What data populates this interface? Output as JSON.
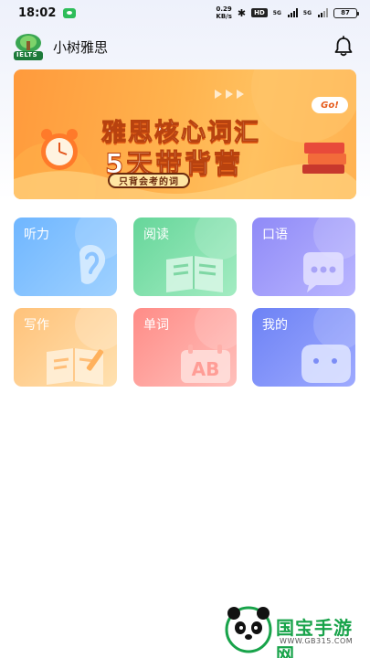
{
  "status_bar": {
    "time": "18:02",
    "net_speed_value": "0.29",
    "net_speed_unit": "KB/s",
    "hd": "HD",
    "sim1": "5G",
    "sim2": "5G",
    "battery": "87"
  },
  "header": {
    "app_name": "小树雅思",
    "logo_text": "IELTS"
  },
  "banner": {
    "line1": "雅思核心词汇",
    "line2": "5天带背营",
    "subtitle": "只背会考的词",
    "go_badge": "Go!"
  },
  "tiles": [
    {
      "label": "听力",
      "icon": "ear-icon"
    },
    {
      "label": "阅读",
      "icon": "book-icon"
    },
    {
      "label": "口语",
      "icon": "chat-bubble-icon"
    },
    {
      "label": "写作",
      "icon": "notebook-pen-icon"
    },
    {
      "label": "单词",
      "icon": "calendar-ab-icon"
    },
    {
      "label": "我的",
      "icon": "face-icon"
    }
  ],
  "watermark": {
    "text": "国宝手游网",
    "url": "WWW.GB315.COM"
  },
  "colors": {
    "banner_orange": "#ff9a3c",
    "listen_blue": "#6fb6ff",
    "read_green": "#66d69a",
    "speak_purple": "#8f8af7",
    "write_orange": "#ffc27a",
    "vocab_red": "#ff8c87",
    "mine_indigo": "#6d82f5"
  }
}
